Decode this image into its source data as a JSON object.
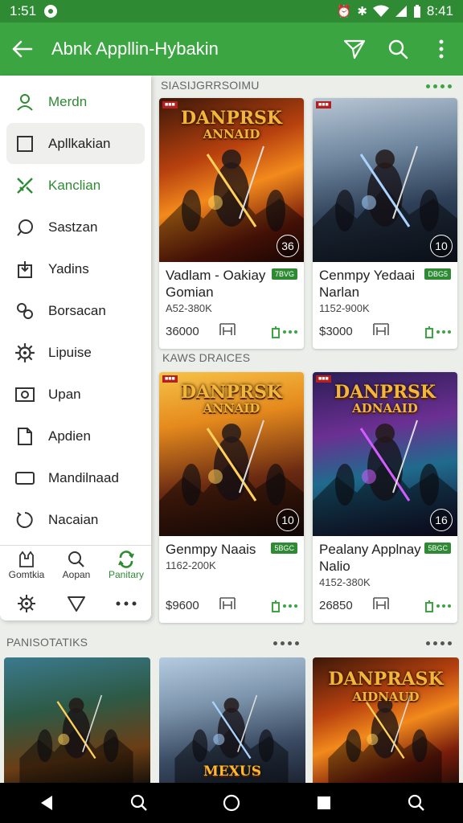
{
  "status": {
    "time": "1:51",
    "clock": "8:41"
  },
  "appbar": {
    "title": "Abnk Appllin-Hybakin"
  },
  "drawer": {
    "items": [
      {
        "label": "Merdn",
        "icon": "person-icon",
        "style": "green"
      },
      {
        "label": "Apllkakian",
        "icon": "square-icon",
        "style": "sel"
      },
      {
        "label": "Kanclian",
        "icon": "tools-icon",
        "style": "green"
      },
      {
        "label": "Sastzan",
        "icon": "chat-bubble-icon",
        "style": ""
      },
      {
        "label": "Yadins",
        "icon": "download-box-icon",
        "style": ""
      },
      {
        "label": "Borsacan",
        "icon": "link-icon",
        "style": ""
      },
      {
        "label": "Lipuise",
        "icon": "gear-icon",
        "style": ""
      },
      {
        "label": "Upan",
        "icon": "camera-box-icon",
        "style": ""
      },
      {
        "label": "Apdien",
        "icon": "document-icon",
        "style": ""
      },
      {
        "label": "Mandilnaad",
        "icon": "rectangle-icon",
        "style": ""
      },
      {
        "label": "Nacaian",
        "icon": "refresh-circle-icon",
        "style": ""
      }
    ],
    "grid": [
      {
        "label": "Gomtkia",
        "icon": "castle-icon"
      },
      {
        "label": "Aopan",
        "icon": "search-icon"
      },
      {
        "label": "Panitary",
        "icon": "sync-icon"
      }
    ]
  },
  "sections": {
    "s1": "SIASIJGRRSOIMU",
    "s2": "KAWS DRAICES",
    "s3": "PANISOTATIKS"
  },
  "cards": [
    {
      "logo": "DANPRSK",
      "logo2": "ANNAID",
      "num": "36",
      "name": "Vadlam - Oakiay Gomian",
      "badge": "7BVG",
      "range": "A52-380K",
      "price": "36000",
      "theme": "fire"
    },
    {
      "logo": "",
      "logo2": "",
      "num": "10",
      "name": "Cenmpy Yedaai Narlan",
      "badge": "DBG5",
      "range": "1152-900K",
      "price": "$3000",
      "theme": "storm"
    },
    {
      "logo": "DANPRSK",
      "logo2": "ANNAID",
      "num": "10",
      "name": "Genmpy Naais",
      "badge": "5BGC",
      "range": "1162-200K",
      "price": "$9600",
      "theme": "gold"
    },
    {
      "logo": "DANPRSK",
      "logo2": "ADNAAID",
      "num": "16",
      "name": "Pealany Applnay Nalio",
      "badge": "5BGC",
      "range": "4152-380K",
      "price": "26850",
      "theme": "violet"
    }
  ],
  "bottom_cards": [
    {
      "logo": "",
      "logo2": "",
      "theme": "field"
    },
    {
      "logo": "MEXUS",
      "logo2": "",
      "theme": "sky"
    },
    {
      "logo": "DANPRASK",
      "logo2": "AIDNAUD",
      "theme": "fire"
    }
  ],
  "colors": {
    "brand": "#3aa541",
    "brand_dark": "#2e8b34"
  }
}
